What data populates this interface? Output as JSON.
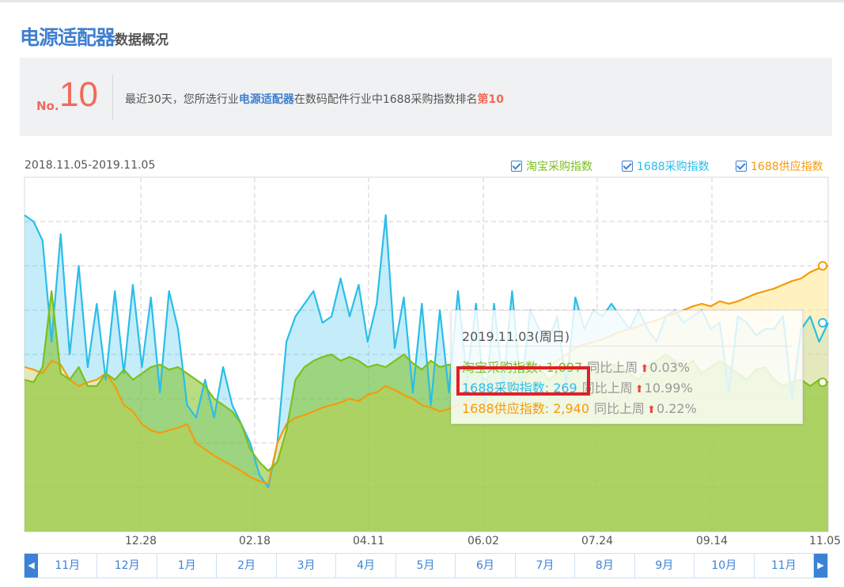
{
  "header": {
    "title_main": "电源适配器",
    "title_sub": "数据概况"
  },
  "rank": {
    "no_label": "No.",
    "number": "10",
    "text_pre": "最近30天，您所选行业",
    "text_industry": "电源适配器",
    "text_mid": "在数码配件行业中1688采购指数排名",
    "text_rank": "第10"
  },
  "legend": {
    "items": [
      {
        "label": "淘宝采购指数",
        "color": "#7dbf1c"
      },
      {
        "label": "1688采购指数",
        "color": "#2bbde8"
      },
      {
        "label": "1688供应指数",
        "color": "#f59b0a"
      }
    ]
  },
  "tooltip": {
    "date": "2019.11.03(周日)",
    "compare_label": "同比上周",
    "rows": [
      {
        "label": "淘宝采购指数: 1,097",
        "pct": "0.03%",
        "color": "#7dbf1c"
      },
      {
        "label": "1688采购指数: 269",
        "pct": "10.99%",
        "color": "#2bbde8"
      },
      {
        "label": "1688供应指数: 2,940",
        "pct": "0.22%",
        "color": "#f59b0a"
      }
    ]
  },
  "timeline": {
    "months": [
      "11月",
      "12月",
      "1月",
      "2月",
      "3月",
      "4月",
      "5月",
      "6月",
      "7月",
      "8月",
      "9月",
      "10月",
      "11月"
    ]
  },
  "chart_data": {
    "type": "area",
    "date_range": "2018.11.05-2019.11.05",
    "xlabels": [
      "12.28",
      "02.18",
      "04.11",
      "06.02",
      "07.24",
      "09.14",
      "11.05"
    ],
    "grid": true,
    "series": [
      {
        "name": "淘宝采购指数",
        "color": "#7dbf1c",
        "values": [
          1200,
          1180,
          1300,
          1900,
          1250,
          1200,
          1300,
          1150,
          1150,
          1250,
          1200,
          1280,
          1200,
          1250,
          1300,
          1320,
          1280,
          1300,
          1250,
          1200,
          1150,
          1050,
          1000,
          950,
          850,
          650,
          550,
          480,
          550,
          800,
          1200,
          1300,
          1350,
          1380,
          1400,
          1350,
          1380,
          1350,
          1300,
          1320,
          1300,
          1350,
          1400,
          1330,
          1280,
          1350,
          1300,
          1320,
          1280,
          1250,
          1300,
          1200,
          1250,
          1300,
          1350,
          1280,
          1250,
          1300,
          1200,
          1250,
          1320,
          1280,
          1300,
          1350,
          1300,
          1320,
          1300,
          1250,
          1200,
          1300,
          1350,
          1400,
          1350,
          1300,
          1350,
          1250,
          1300,
          1350,
          1300,
          1250,
          1200,
          1280,
          1300,
          1200,
          1150,
          1180,
          1200,
          1150,
          1200,
          1180
        ]
      },
      {
        "name": "1688采购指数",
        "color": "#2bbde8",
        "values": [
          2500,
          2450,
          2300,
          1500,
          2350,
          1400,
          2100,
          1300,
          1800,
          1200,
          1900,
          1250,
          1950,
          1300,
          1850,
          1100,
          1900,
          1600,
          1000,
          900,
          1200,
          900,
          1300,
          1000,
          850,
          700,
          450,
          350,
          700,
          1500,
          1700,
          1800,
          1900,
          1650,
          1700,
          2000,
          1700,
          1950,
          1500,
          1800,
          2500,
          1450,
          1850,
          1100,
          1800,
          1000,
          1750,
          1100,
          1900,
          1200,
          1800,
          1000,
          1800,
          1150,
          1900,
          1100,
          1750,
          1600,
          1500,
          1700,
          1150,
          1850,
          1600,
          1750,
          1700,
          1800,
          1700,
          1600,
          1750,
          1600,
          1500,
          1700,
          1750,
          1650,
          1700,
          1750,
          1600,
          1650,
          1100,
          1700,
          1650,
          1550,
          1600,
          1600,
          1700,
          1050,
          1600,
          1700,
          1500,
          1650
        ]
      },
      {
        "name": "1688供应指数",
        "color": "#f59b0a",
        "values": [
          1300,
          1280,
          1250,
          1350,
          1320,
          1200,
          1150,
          1180,
          1200,
          1250,
          1150,
          1000,
          950,
          850,
          800,
          780,
          800,
          820,
          850,
          700,
          650,
          600,
          560,
          520,
          480,
          430,
          400,
          380,
          700,
          850,
          900,
          920,
          950,
          980,
          1000,
          1020,
          1050,
          1030,
          1080,
          1100,
          1150,
          1120,
          1080,
          1050,
          1000,
          980,
          950,
          970,
          1000,
          1030,
          1050,
          1080,
          1100,
          1150,
          1180,
          1200,
          1250,
          1280,
          1300,
          1350,
          1400,
          1450,
          1480,
          1500,
          1520,
          1550,
          1580,
          1600,
          1620,
          1650,
          1670,
          1700,
          1720,
          1750,
          1780,
          1800,
          1780,
          1820,
          1800,
          1820,
          1850,
          1880,
          1900,
          1920,
          1950,
          1980,
          2000,
          2050,
          2080,
          2100
        ]
      }
    ]
  }
}
